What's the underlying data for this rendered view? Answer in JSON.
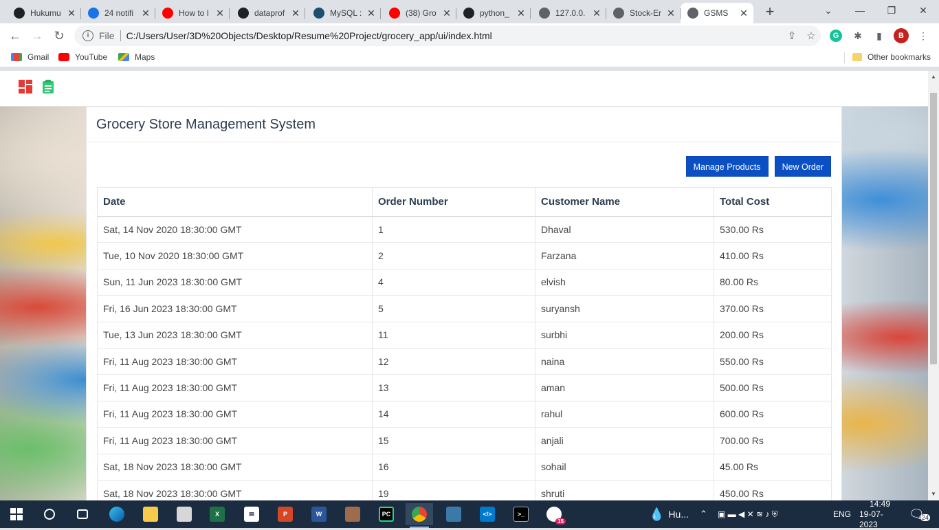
{
  "browser": {
    "tabs": [
      {
        "title": "Hukumu",
        "icon": "hukumu-icon",
        "color": "#202124"
      },
      {
        "title": "24 notifi",
        "icon": "notification-icon",
        "color": "#1a73e8"
      },
      {
        "title": "How to I",
        "icon": "youtube-icon",
        "color": "#ff0000"
      },
      {
        "title": "dataprof",
        "icon": "github-icon",
        "color": "#202124"
      },
      {
        "title": "MySQL :",
        "icon": "mysql-icon",
        "color": "#1d4e6e"
      },
      {
        "title": "(38) Gro",
        "icon": "youtube-icon",
        "color": "#ff0000"
      },
      {
        "title": "python_",
        "icon": "github-icon",
        "color": "#202124"
      },
      {
        "title": "127.0.0.",
        "icon": "globe-icon",
        "color": "#5f6368"
      },
      {
        "title": "Stock-Er",
        "icon": "globe-icon",
        "color": "#5f6368"
      },
      {
        "title": "GSMS",
        "icon": "globe-icon",
        "color": "#5f6368"
      }
    ],
    "address": {
      "scheme_label": "File",
      "url": "C:/Users/User/3D%20Objects/Desktop/Resume%20Project/grocery_app/ui/index.html"
    },
    "profile_initial": "B",
    "bookmarks": [
      {
        "label": "Gmail",
        "icon": "gmail-icon"
      },
      {
        "label": "YouTube",
        "icon": "youtube-icon"
      },
      {
        "label": "Maps",
        "icon": "maps-icon"
      }
    ],
    "other_bookmarks": "Other bookmarks"
  },
  "app": {
    "title": "Grocery Store Management System",
    "buttons": {
      "manage_products": "Manage Products",
      "new_order": "New Order"
    },
    "table": {
      "headers": [
        "Date",
        "Order Number",
        "Customer Name",
        "Total Cost"
      ],
      "rows": [
        [
          "Sat, 14 Nov 2020 18:30:00 GMT",
          "1",
          "Dhaval",
          "530.00 Rs"
        ],
        [
          "Tue, 10 Nov 2020 18:30:00 GMT",
          "2",
          "Farzana",
          "410.00 Rs"
        ],
        [
          "Sun, 11 Jun 2023 18:30:00 GMT",
          "4",
          "elvish",
          "80.00 Rs"
        ],
        [
          "Fri, 16 Jun 2023 18:30:00 GMT",
          "5",
          "suryansh",
          "370.00 Rs"
        ],
        [
          "Tue, 13 Jun 2023 18:30:00 GMT",
          "11",
          "surbhi",
          "200.00 Rs"
        ],
        [
          "Fri, 11 Aug 2023 18:30:00 GMT",
          "12",
          "naina",
          "550.00 Rs"
        ],
        [
          "Fri, 11 Aug 2023 18:30:00 GMT",
          "13",
          "aman",
          "500.00 Rs"
        ],
        [
          "Fri, 11 Aug 2023 18:30:00 GMT",
          "14",
          "rahul",
          "600.00 Rs"
        ],
        [
          "Fri, 11 Aug 2023 18:30:00 GMT",
          "15",
          "anjali",
          "700.00 Rs"
        ],
        [
          "Sat, 18 Nov 2023 18:30:00 GMT",
          "16",
          "sohail",
          "45.00 Rs"
        ],
        [
          "Sat, 18 Nov 2023 18:30:00 GMT",
          "19",
          "shruti",
          "450.00 Rs"
        ]
      ]
    }
  },
  "taskbar": {
    "weather": "Hu...",
    "language": "ENG",
    "time": "14:49",
    "date": "19-07-2023",
    "notifications": "24",
    "slack_badge": "15"
  }
}
